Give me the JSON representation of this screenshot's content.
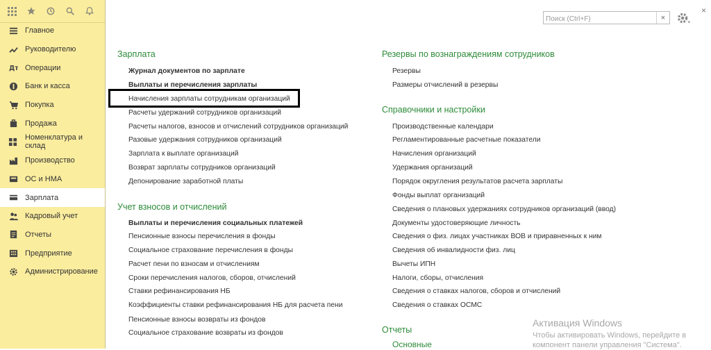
{
  "sidebar": {
    "top_icons": [
      "grid-icon",
      "star-icon",
      "history-icon",
      "search-icon",
      "bell-icon"
    ],
    "items": [
      {
        "label": "Главное",
        "icon": "list-icon"
      },
      {
        "label": "Руководителю",
        "icon": "trend-icon"
      },
      {
        "label": "Операции",
        "icon": "operations-icon"
      },
      {
        "label": "Банк и касса",
        "icon": "bank-icon"
      },
      {
        "label": "Покупка",
        "icon": "cart-icon"
      },
      {
        "label": "Продажа",
        "icon": "bag-icon"
      },
      {
        "label": "Номенклатура и склад",
        "icon": "warehouse-icon"
      },
      {
        "label": "Производство",
        "icon": "factory-icon"
      },
      {
        "label": "ОС и НМА",
        "icon": "assets-icon"
      },
      {
        "label": "Зарплата",
        "icon": "salary-icon"
      },
      {
        "label": "Кадровый учет",
        "icon": "people-icon"
      },
      {
        "label": "Отчеты",
        "icon": "reports-icon"
      },
      {
        "label": "Предприятие",
        "icon": "enterprise-icon"
      },
      {
        "label": "Администрирование",
        "icon": "gear-icon"
      }
    ],
    "active_index": 9
  },
  "search": {
    "placeholder": "Поиск (Ctrl+F)",
    "clear": "×"
  },
  "close_label": "×",
  "left": {
    "salary": {
      "title": "Зарплата",
      "links": [
        {
          "label": "Журнал документов по зарплате",
          "bold": true
        },
        {
          "label": "Выплаты и перечисления зарплаты",
          "bold": true
        },
        {
          "label": "Начисления зарплаты сотрудникам организаций",
          "bold": false
        },
        {
          "label": "Расчеты удержаний сотрудников организаций",
          "bold": false
        },
        {
          "label": "Расчеты налогов, взносов и отчислений сотрудников организаций",
          "bold": false
        },
        {
          "label": "Разовые удержания сотрудников организаций",
          "bold": false
        },
        {
          "label": "Зарплата к выплате организаций",
          "bold": false
        },
        {
          "label": "Возврат зарплаты сотрудников организаций",
          "bold": false
        },
        {
          "label": "Депонирование заработной платы",
          "bold": false
        }
      ]
    },
    "contrib": {
      "title": "Учет взносов и отчислений",
      "links": [
        {
          "label": "Выплаты и перечисления социальных платежей",
          "bold": true
        },
        {
          "label": "Пенсионные взносы перечисления в фонды",
          "bold": false
        },
        {
          "label": "Социальное страхование перечисления в фонды",
          "bold": false
        },
        {
          "label": "Расчет пени по взносам и отчислениям",
          "bold": false
        },
        {
          "label": "Сроки перечисления налогов, сборов, отчислений",
          "bold": false
        },
        {
          "label": "Ставки рефинансирования НБ",
          "bold": false
        },
        {
          "label": "Коэффициенты ставки рефинансирования НБ для расчета пени",
          "bold": false
        },
        {
          "label": "Пенсионные взносы возвраты из фондов",
          "bold": false
        },
        {
          "label": "Социальное страхование возвраты из фондов",
          "bold": false
        }
      ]
    }
  },
  "right": {
    "reserves": {
      "title": "Резервы по вознаграждениям сотрудников",
      "links": [
        {
          "label": "Резервы"
        },
        {
          "label": "Размеры отчислений в резервы"
        }
      ]
    },
    "settings": {
      "title": "Справочники и настройки",
      "links": [
        {
          "label": "Производственные календари"
        },
        {
          "label": "Регламентированные расчетные показатели"
        },
        {
          "label": "Начисления организаций"
        },
        {
          "label": "Удержания организаций"
        },
        {
          "label": "Порядок округления результатов расчета зарплаты"
        },
        {
          "label": "Фонды выплат организаций"
        },
        {
          "label": "Сведения о плановых удержаниях сотрудников организаций (ввод)"
        },
        {
          "label": "Документы удостоверяющие личность"
        },
        {
          "label": "Сведения о физ. лицах участниках ВОВ и приравненных к ним"
        },
        {
          "label": "Сведения об инвалидности физ. лиц"
        },
        {
          "label": "Вычеты ИПН"
        },
        {
          "label": "Налоги, сборы, отчисления"
        },
        {
          "label": "Сведения о ставках налогов, сборов и отчислений"
        },
        {
          "label": "Сведения о ставках ОСМС"
        }
      ]
    },
    "reports": {
      "title": "Отчеты",
      "subtitle": "Основные"
    }
  },
  "watermark": {
    "line1": "Активация Windows",
    "line2": "Чтобы активировать Windows, перейдите в",
    "line3": "компонент панели управления \"Система\"."
  },
  "colors": {
    "sidebar_bg": "#fbed9e",
    "section_title": "#2e8b3a",
    "highlight_border": "#000000"
  }
}
